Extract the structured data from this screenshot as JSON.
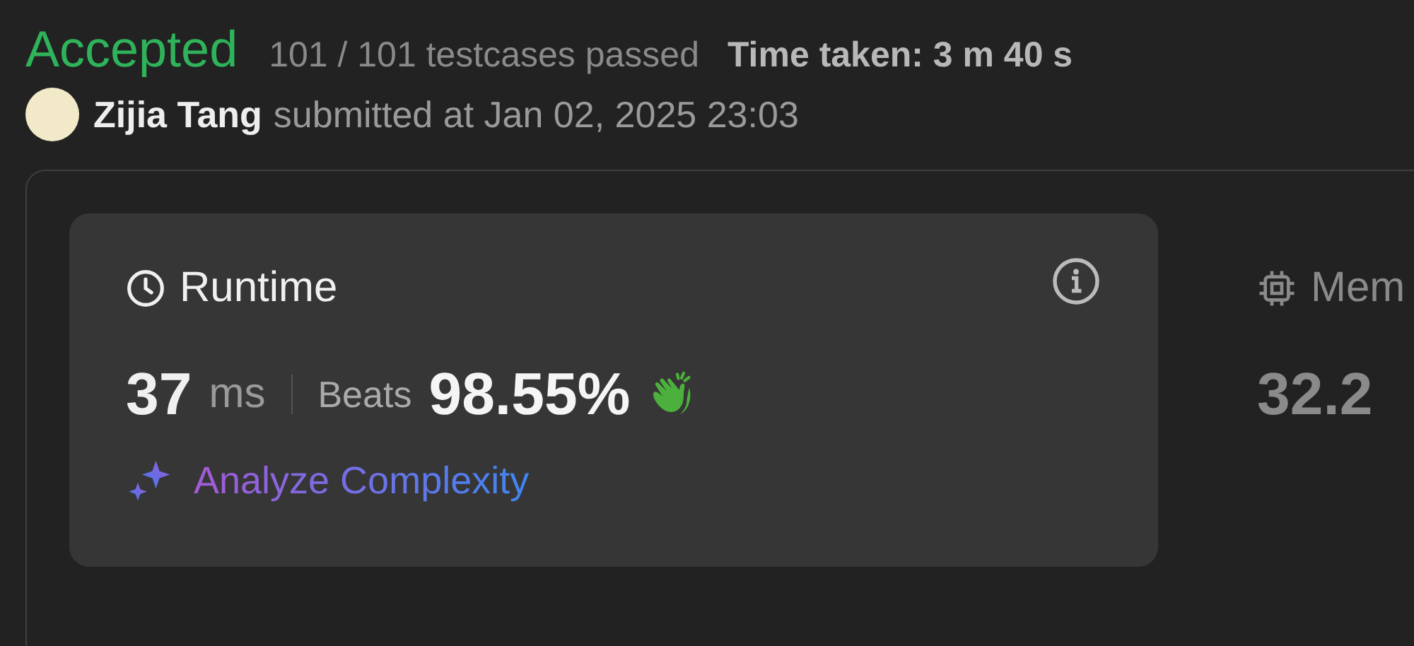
{
  "status": {
    "verdict": "Accepted",
    "testcases": "101 / 101 testcases passed",
    "time_taken": "Time taken: 3 m 40 s"
  },
  "submission": {
    "user": "Zijia Tang",
    "submitted": "submitted at Jan 02, 2025 23:03"
  },
  "metrics": [
    {
      "kind": "runtime",
      "title": "Runtime",
      "selected": true,
      "value": "37",
      "unit": "ms",
      "beats_label": "Beats",
      "beats": "98.55%",
      "action": "Analyze Complexity"
    },
    {
      "kind": "memory",
      "title": "Mem",
      "selected": false,
      "value": "32.2"
    }
  ]
}
